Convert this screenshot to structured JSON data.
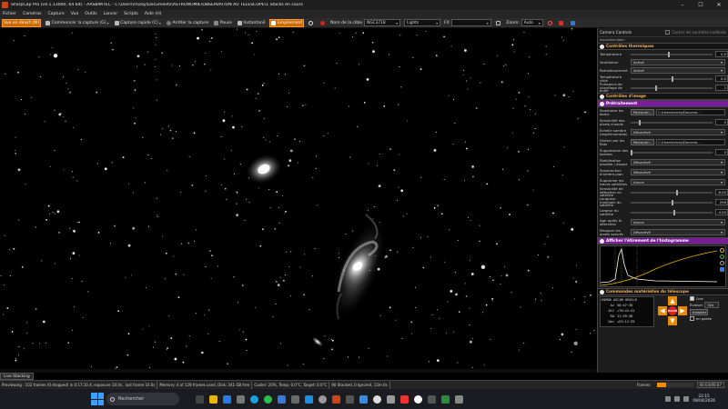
{
  "window": {
    "title": "SharpCap Pro (v4.1.13000, 64 bit) - AASBIMTEC - C:\\Users\\micky\\Documents\\ASTRONOMIE\\OBSERVATION AU TELESCOPE\\1 Stacks en cours",
    "minimize": "–",
    "maximize": "☐",
    "close": "✕"
  },
  "menu": [
    "Fichier",
    "Caméras",
    "Capture",
    "Vue",
    "Outils",
    "Lancer",
    "Scripts",
    "Aide (H)"
  ],
  "toolbar": {
    "live_view": "Vue en direct (W)",
    "start_capture": "Commencer la capture (G)",
    "quick_capture": "Capture rapide (C)",
    "stop_capture": "Arrêter la capture",
    "pause": "Pause",
    "snapshot": "Instantané",
    "stacking": "Empilement",
    "target_label": "Nom de la cible",
    "target_value": "NGC3718",
    "frame_type": "Lights",
    "fx_label": "FX",
    "fx_value": "",
    "zoom_label": "Zoom:",
    "zoom_value": "Auto"
  },
  "panel": {
    "camera_controls": "Camera Controls",
    "exposure_gain": "exposition/gain",
    "hide_unused": "Cacher les contrôles inutilisés",
    "sections": {
      "thermal": "Contrôles thermiques",
      "image": "Contrôles d'image",
      "preprocessing": "Prétraitement",
      "histogram": "Afficher l'étirement de l'histogramme",
      "telescope": "Commandes matérielles du télescope"
    },
    "thermal_rows": [
      {
        "label": "Température",
        "value": "0.0"
      },
      {
        "label": "Ventilateur",
        "value": "Activé"
      },
      {
        "label": "Refroidissement",
        "value": "Activé"
      },
      {
        "label": "Température cible",
        "value": "0.0"
      },
      {
        "label": "Puissance de chauffage de buée",
        "value": "2"
      }
    ],
    "pre_rows": [
      {
        "label": "Soustraire les darks",
        "button": "Parcourir...",
        "path": "C:\\Users\\micky\\Docume..."
      },
      {
        "label": "Sensibilité des pixels chauds",
        "value": "5"
      },
      {
        "label": "Échelle sombre (expérimentale)",
        "value": "Désactivé"
      },
      {
        "label": "Diviser par les flats",
        "button": "Parcourir...",
        "path": "C:\\Users\\micky\\Docume..."
      },
      {
        "label": "Suppression des bandes",
        "value": "0"
      },
      {
        "label": "Stabilisation planète / disque",
        "value": "Désactivé"
      },
      {
        "label": "Soustraction d'arrière-plan",
        "value": "Désactivé"
      },
      {
        "label": "Supprimer les traces satellites",
        "value": "Aucun"
      },
      {
        "label": "Sensibilité de détection du satellite",
        "value": "8.00"
      },
      {
        "label": "Longueur minimale du satellite",
        "value": "256"
      },
      {
        "label": "Largeur du satellite",
        "value": "4.00"
      },
      {
        "label": "Agir après la détection",
        "value": "Aucun"
      },
      {
        "label": "Masquer les pixels saturés",
        "value": "Désactivé"
      }
    ],
    "scope": {
      "device": "EQMOD ASCOM HEQ5/6",
      "live_label": "Live",
      "rows": [
        {
          "k": "Az",
          "v": "50:47:30"
        },
        {
          "k": "Alt",
          "v": "+70:41:41"
        },
        {
          "k": "RA",
          "v": "11:59:38"
        },
        {
          "k": "Dec",
          "v": "+53:12:35"
        }
      ],
      "center_label": "HALTE",
      "eval_label": "Évaluer",
      "speed": "32x",
      "install_label": "Installer",
      "park_label": "en garde"
    }
  },
  "live_tab": "Live Stacking",
  "status": {
    "previewing": "Previewing : 102 frames (0 dropped) in 0:17:10.4, exposure 10.0s , last frame 10.0s",
    "memory": "Memory: 4 of 129 frames used, Disk: 341 GB free",
    "cooler": "Cooler: 20%, Temp: 0.0°C, Target: 0.0°C",
    "stacked": "90 Stacked, 0 Ignored, 15m 0s",
    "frames_label": "Frames:",
    "frames_progress": 0.25,
    "frames_time": "00:03/00:07"
  },
  "taskbar": {
    "search": "Rechercher",
    "time": "22:15",
    "date": "09/04/2026"
  },
  "colors": {
    "accent": "#ff8a00",
    "purple": "#7b1c9a",
    "section_text": "#f0b060"
  }
}
